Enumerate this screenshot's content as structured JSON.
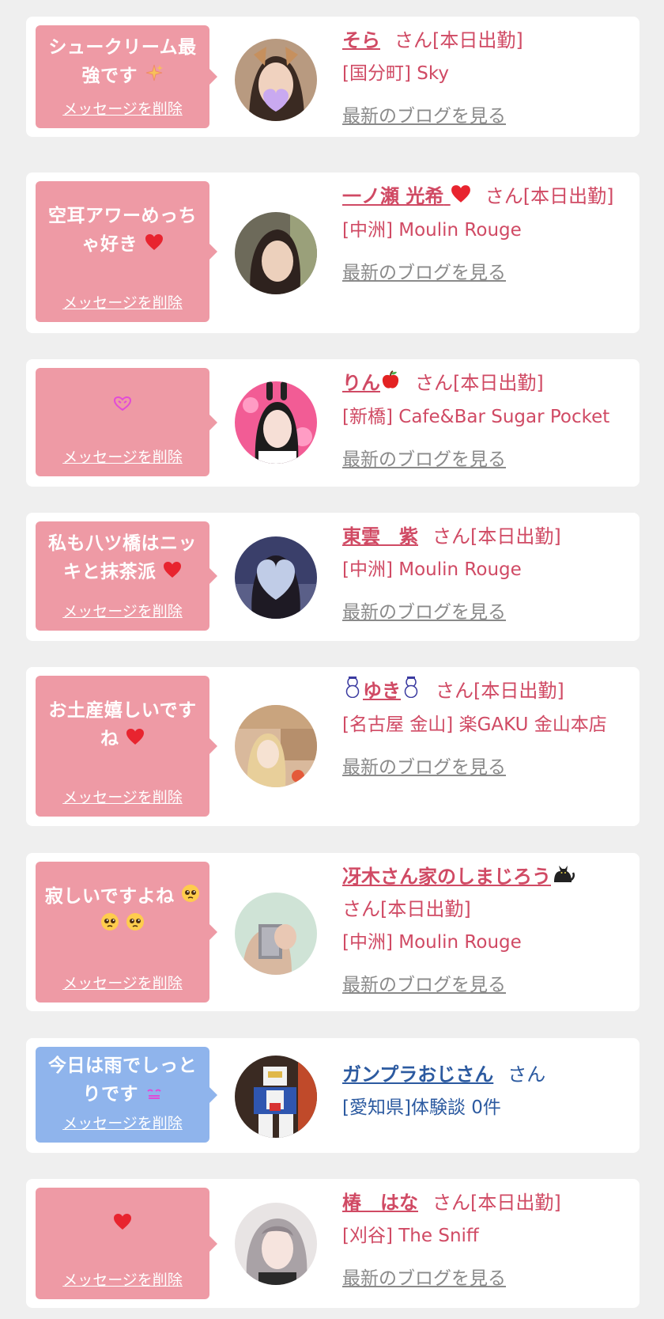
{
  "delete_label": "メッセージを削除",
  "blog_label": "最新のブログを見る",
  "cards": [
    {
      "message": "シュークリーム最強です",
      "name": "そら",
      "suffix": "さん[本日出勤]",
      "shop": "[国分町] Sky",
      "icon": "sparkles-icon"
    },
    {
      "message": "空耳アワーめっちゃ好き",
      "name": "一ノ瀬 光希",
      "suffix": "さん[本日出勤]",
      "shop": "[中洲] Moulin Rouge",
      "icon": "heart-icon"
    },
    {
      "message": "",
      "name": "りん",
      "suffix": "さん[本日出勤]",
      "shop": "[新橋] Cafe&Bar Sugar Pocket",
      "icon": "heart-eyes-icon"
    },
    {
      "message": "私も八ツ橋はニッキと抹茶派",
      "name": "東雲　紫",
      "suffix": "さん[本日出勤]",
      "shop": "[中洲] Moulin Rouge",
      "icon": "heart-icon"
    },
    {
      "message": "お土産嬉しいですね",
      "name": "ゆき",
      "suffix": "さん[本日出勤]",
      "shop": "[名古屋 金山] 楽GAKU 金山本店",
      "icon": "heart-icon"
    },
    {
      "message": "寂しいですよね",
      "name": "冴木さん家のしまじろう",
      "suffix": "さん[本日出勤]",
      "shop": "[中洲] Moulin Rouge",
      "icon": "pleading-face-icon"
    },
    {
      "message": "今日は雨でしっとりです",
      "name": "ガンプラおじさん",
      "suffix": "さん",
      "shop": "[愛知県]体験談 0件",
      "icon": "smiling-face-icon"
    },
    {
      "message": "",
      "name": "椿　はな",
      "suffix": "さん[本日出勤]",
      "shop": "[刈谷] The Sniff",
      "icon": "heart-icon"
    }
  ],
  "colors": {
    "background": "#efefef",
    "card": "#ffffff",
    "pink_bubble": "#ee9aa5",
    "blue_bubble": "#8fb4ec",
    "pink_text": "#d04a64",
    "blue_text": "#2c5aa0",
    "gray_link": "#8a8a8a"
  }
}
